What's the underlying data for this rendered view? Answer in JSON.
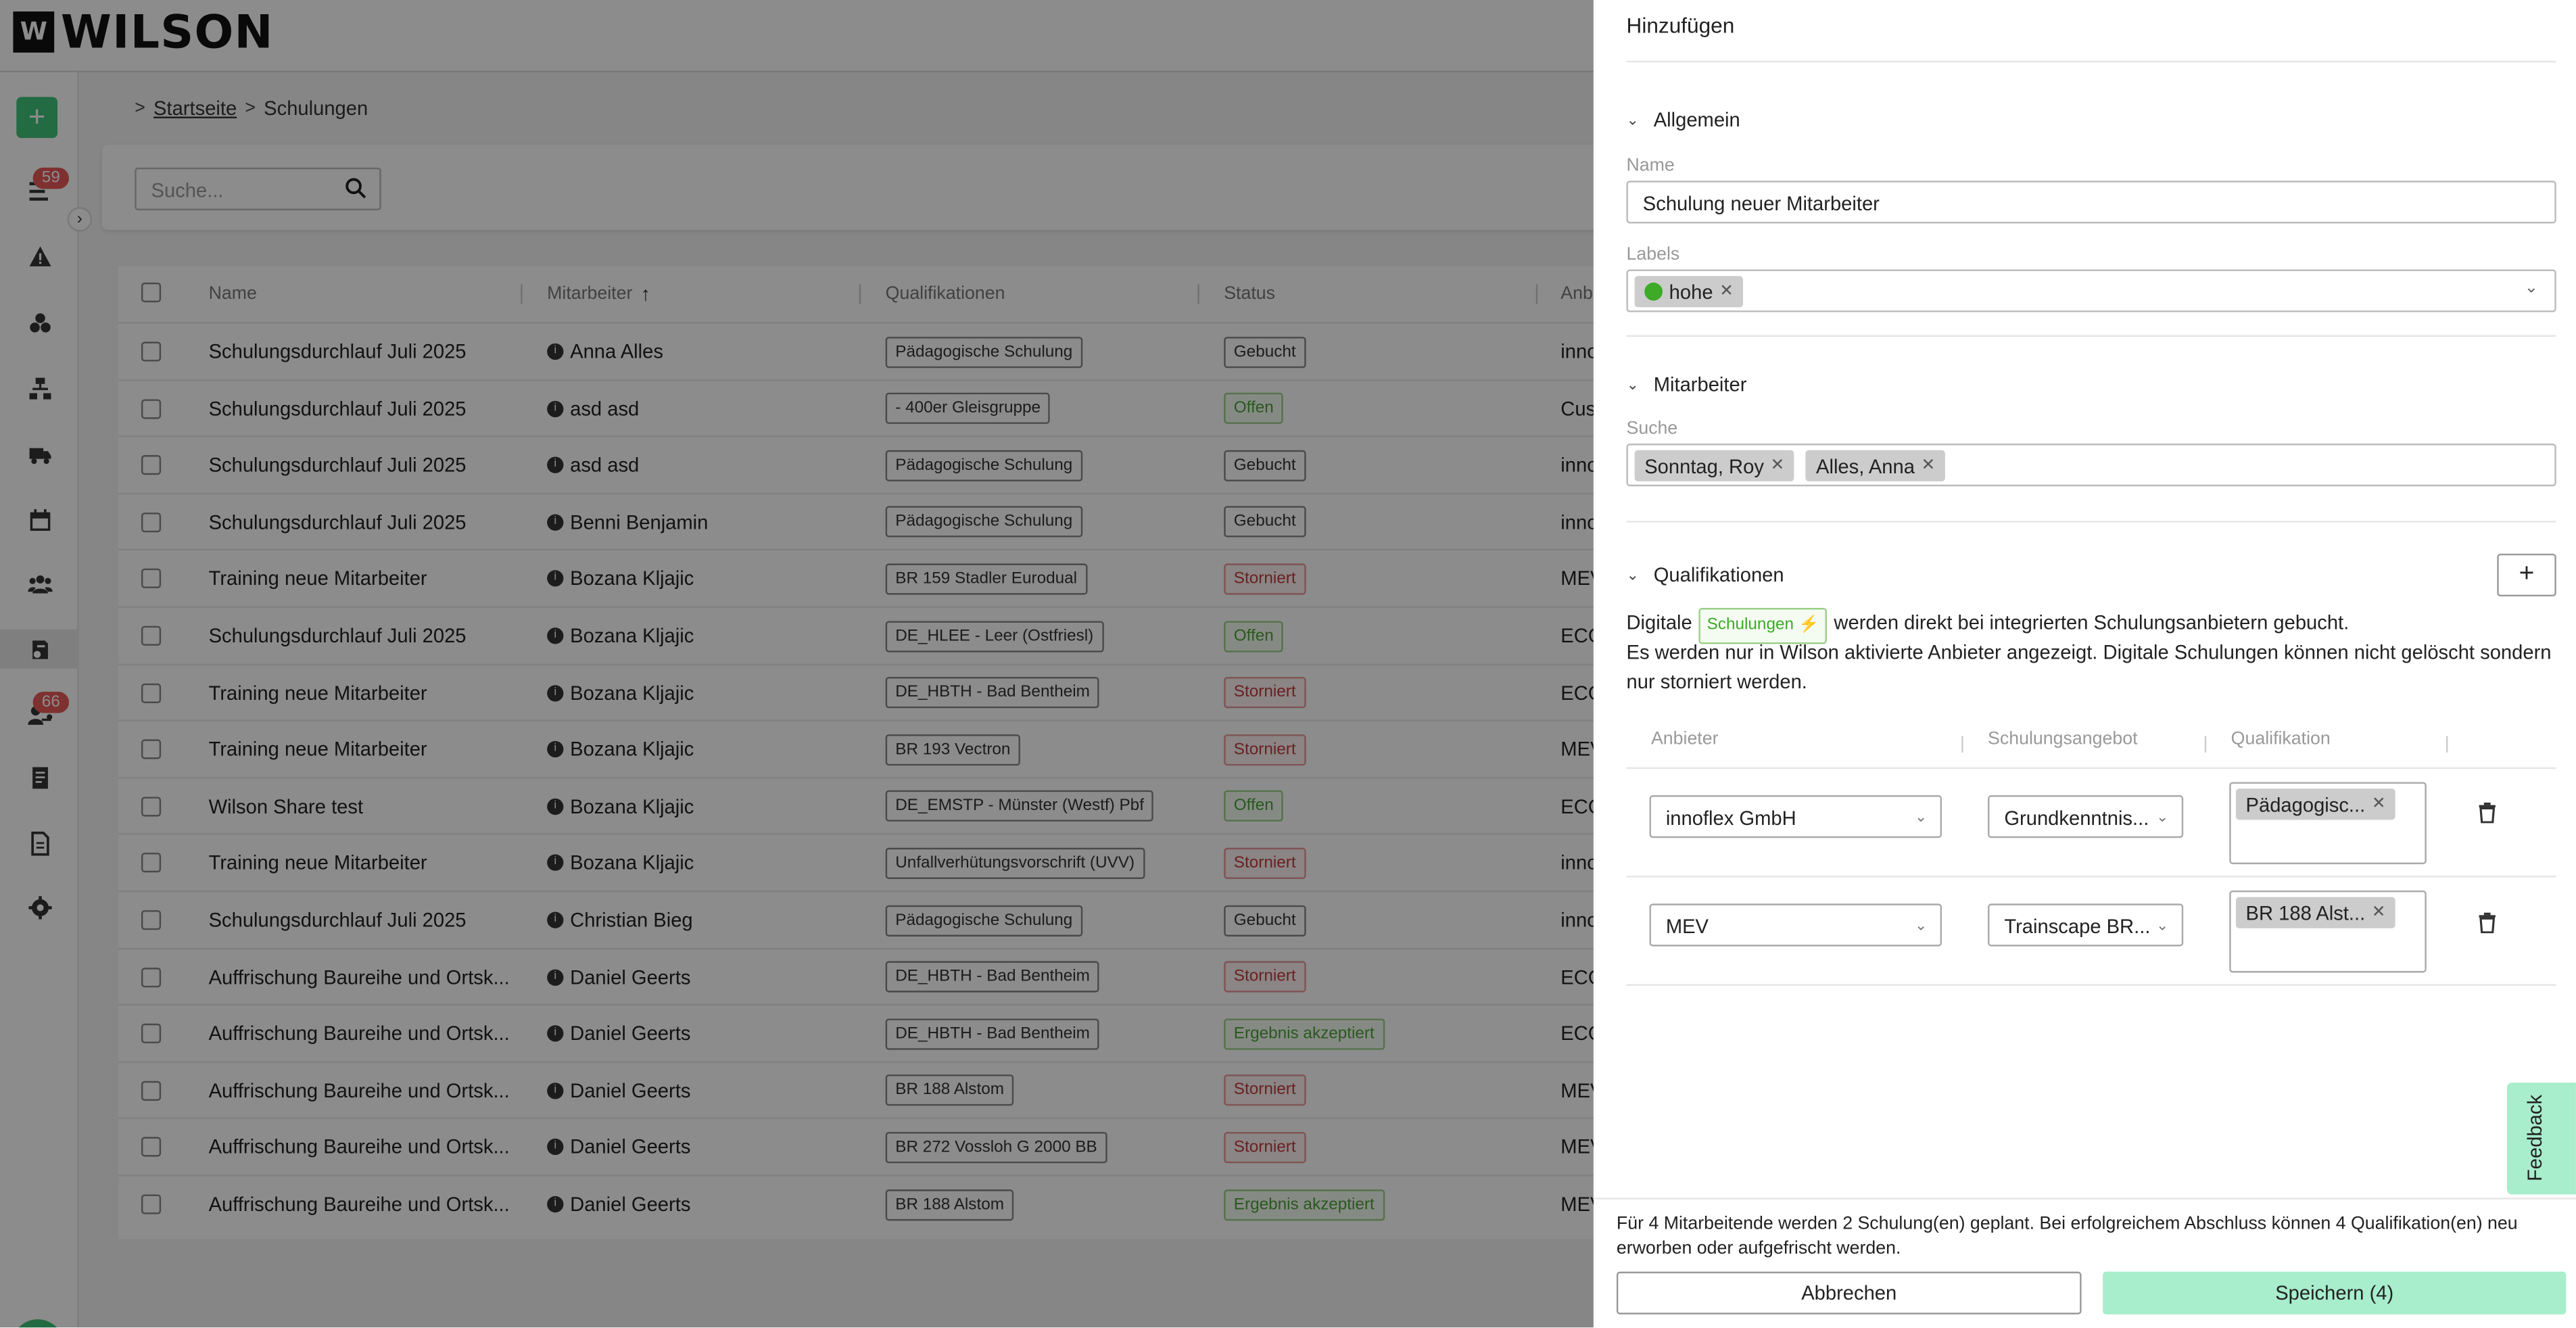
{
  "app": {
    "logo_mark": "W",
    "logo_text": "WILSON"
  },
  "sidebar": {
    "add_label": "+",
    "badge_top": "59",
    "badge_bottom": "66",
    "expand": "›",
    "icons": [
      "list-icon",
      "warning-icon",
      "cubes-icon",
      "org-chart-icon",
      "truck-icon",
      "calendar-icon",
      "users-icon",
      "training-icon",
      "person-key-icon",
      "document-icon",
      "file-icon",
      "gear-icon"
    ]
  },
  "breadcrumb": {
    "home": "Startseite",
    "current": "Schulungen"
  },
  "search": {
    "placeholder": "Suche..."
  },
  "table": {
    "headers": [
      "Name",
      "Mitarbeiter",
      "Qualifikationen",
      "Status",
      "Anb"
    ],
    "rows": [
      {
        "name": "Schulungsdurchlauf Juli 2025",
        "emp": "Anna Alles",
        "qual": "Pädagogische Schulung",
        "status": "Gebucht",
        "st": "gebucht",
        "prov": "inno"
      },
      {
        "name": "Schulungsdurchlauf Juli 2025",
        "emp": "asd asd",
        "qual": "- 400er Gleisgruppe",
        "status": "Offen",
        "st": "offen",
        "prov": "Cust"
      },
      {
        "name": "Schulungsdurchlauf Juli 2025",
        "emp": "asd asd",
        "qual": "Pädagogische Schulung",
        "status": "Gebucht",
        "st": "gebucht",
        "prov": "inno"
      },
      {
        "name": "Schulungsdurchlauf Juli 2025",
        "emp": "Benni Benjamin",
        "qual": "Pädagogische Schulung",
        "status": "Gebucht",
        "st": "gebucht",
        "prov": "inno"
      },
      {
        "name": "Training neue Mitarbeiter",
        "emp": "Bozana Kljajic",
        "qual": "BR 159 Stadler Eurodual",
        "status": "Storniert",
        "st": "storniert",
        "prov": "MEV"
      },
      {
        "name": "Schulungsdurchlauf Juli 2025",
        "emp": "Bozana Kljajic",
        "qual": "DE_HLEE - Leer (Ostfriesl)",
        "status": "Offen",
        "st": "offen",
        "prov": "ECO"
      },
      {
        "name": "Training neue Mitarbeiter",
        "emp": "Bozana Kljajic",
        "qual": "DE_HBTH - Bad Bentheim",
        "status": "Storniert",
        "st": "storniert",
        "prov": "ECO"
      },
      {
        "name": "Training neue Mitarbeiter",
        "emp": "Bozana Kljajic",
        "qual": "BR 193 Vectron",
        "status": "Storniert",
        "st": "storniert",
        "prov": "MEV"
      },
      {
        "name": "Wilson Share test",
        "emp": "Bozana Kljajic",
        "qual": "DE_EMSTP - Münster (Westf) Pbf",
        "status": "Offen",
        "st": "offen",
        "prov": "ECO"
      },
      {
        "name": "Training neue Mitarbeiter",
        "emp": "Bozana Kljajic",
        "qual": "Unfallverhütungsvorschrift (UVV)",
        "status": "Storniert",
        "st": "storniert",
        "prov": "inno"
      },
      {
        "name": "Schulungsdurchlauf Juli 2025",
        "emp": "Christian Bieg",
        "qual": "Pädagogische Schulung",
        "status": "Gebucht",
        "st": "gebucht",
        "prov": "inno"
      },
      {
        "name": "Auffrischung Baureihe und Ortsk...",
        "emp": "Daniel Geerts",
        "qual": "DE_HBTH - Bad Bentheim",
        "status": "Storniert",
        "st": "storniert",
        "prov": "ECO"
      },
      {
        "name": "Auffrischung Baureihe und Ortsk...",
        "emp": "Daniel Geerts",
        "qual": "DE_HBTH - Bad Bentheim",
        "status": "Ergebnis akzeptiert",
        "st": "ergebnis",
        "prov": "ECO"
      },
      {
        "name": "Auffrischung Baureihe und Ortsk...",
        "emp": "Daniel Geerts",
        "qual": "BR 188 Alstom",
        "status": "Storniert",
        "st": "storniert",
        "prov": "MEV"
      },
      {
        "name": "Auffrischung Baureihe und Ortsk...",
        "emp": "Daniel Geerts",
        "qual": "BR 272 Vossloh G 2000 BB",
        "status": "Storniert",
        "st": "storniert",
        "prov": "MEV"
      },
      {
        "name": "Auffrischung Baureihe und Ortsk...",
        "emp": "Daniel Geerts",
        "qual": "BR 188 Alstom",
        "status": "Ergebnis akzeptiert",
        "st": "ergebnis",
        "prov": "MEV"
      }
    ]
  },
  "drawer": {
    "title": "Hinzufügen",
    "general": {
      "title": "Allgemein",
      "name_label": "Name",
      "name_value": "Schulung neuer Mitarbeiter",
      "labels_label": "Labels",
      "label_tag": "hohe"
    },
    "employees": {
      "title": "Mitarbeiter",
      "search_label": "Suche",
      "tags": [
        "Sonntag, Roy",
        "Alles, Anna"
      ]
    },
    "qualifications": {
      "title": "Qualifikationen",
      "add": "+",
      "desc_pre": "Digitale",
      "chip": "Schulungen",
      "desc_post": "werden direkt bei integrierten Schulungsanbietern gebucht.",
      "desc2": "Es werden nur in Wilson aktivierte Anbieter angezeigt. Digitale Schulungen können nicht gelöscht sondern nur storniert werden.",
      "headers": [
        "Anbieter",
        "Schulungsangebot",
        "Qualifikation"
      ],
      "rows": [
        {
          "provider": "innoflex GmbH",
          "offer": "Grundkenntnis...",
          "qual": "Pädagogisc..."
        },
        {
          "provider": "MEV",
          "offer": "Trainscape BR...",
          "qual": "BR 188 Alst..."
        }
      ]
    },
    "footer_note": "Für 4 Mitarbeitende werden 2 Schulung(en) geplant. Bei erfolgreichem Abschluss können 4 Qualifikation(en) neu erworben oder aufgefrischt werden.",
    "cancel": "Abbrechen",
    "save": "Speichern (4)",
    "feedback": "Feedback"
  }
}
